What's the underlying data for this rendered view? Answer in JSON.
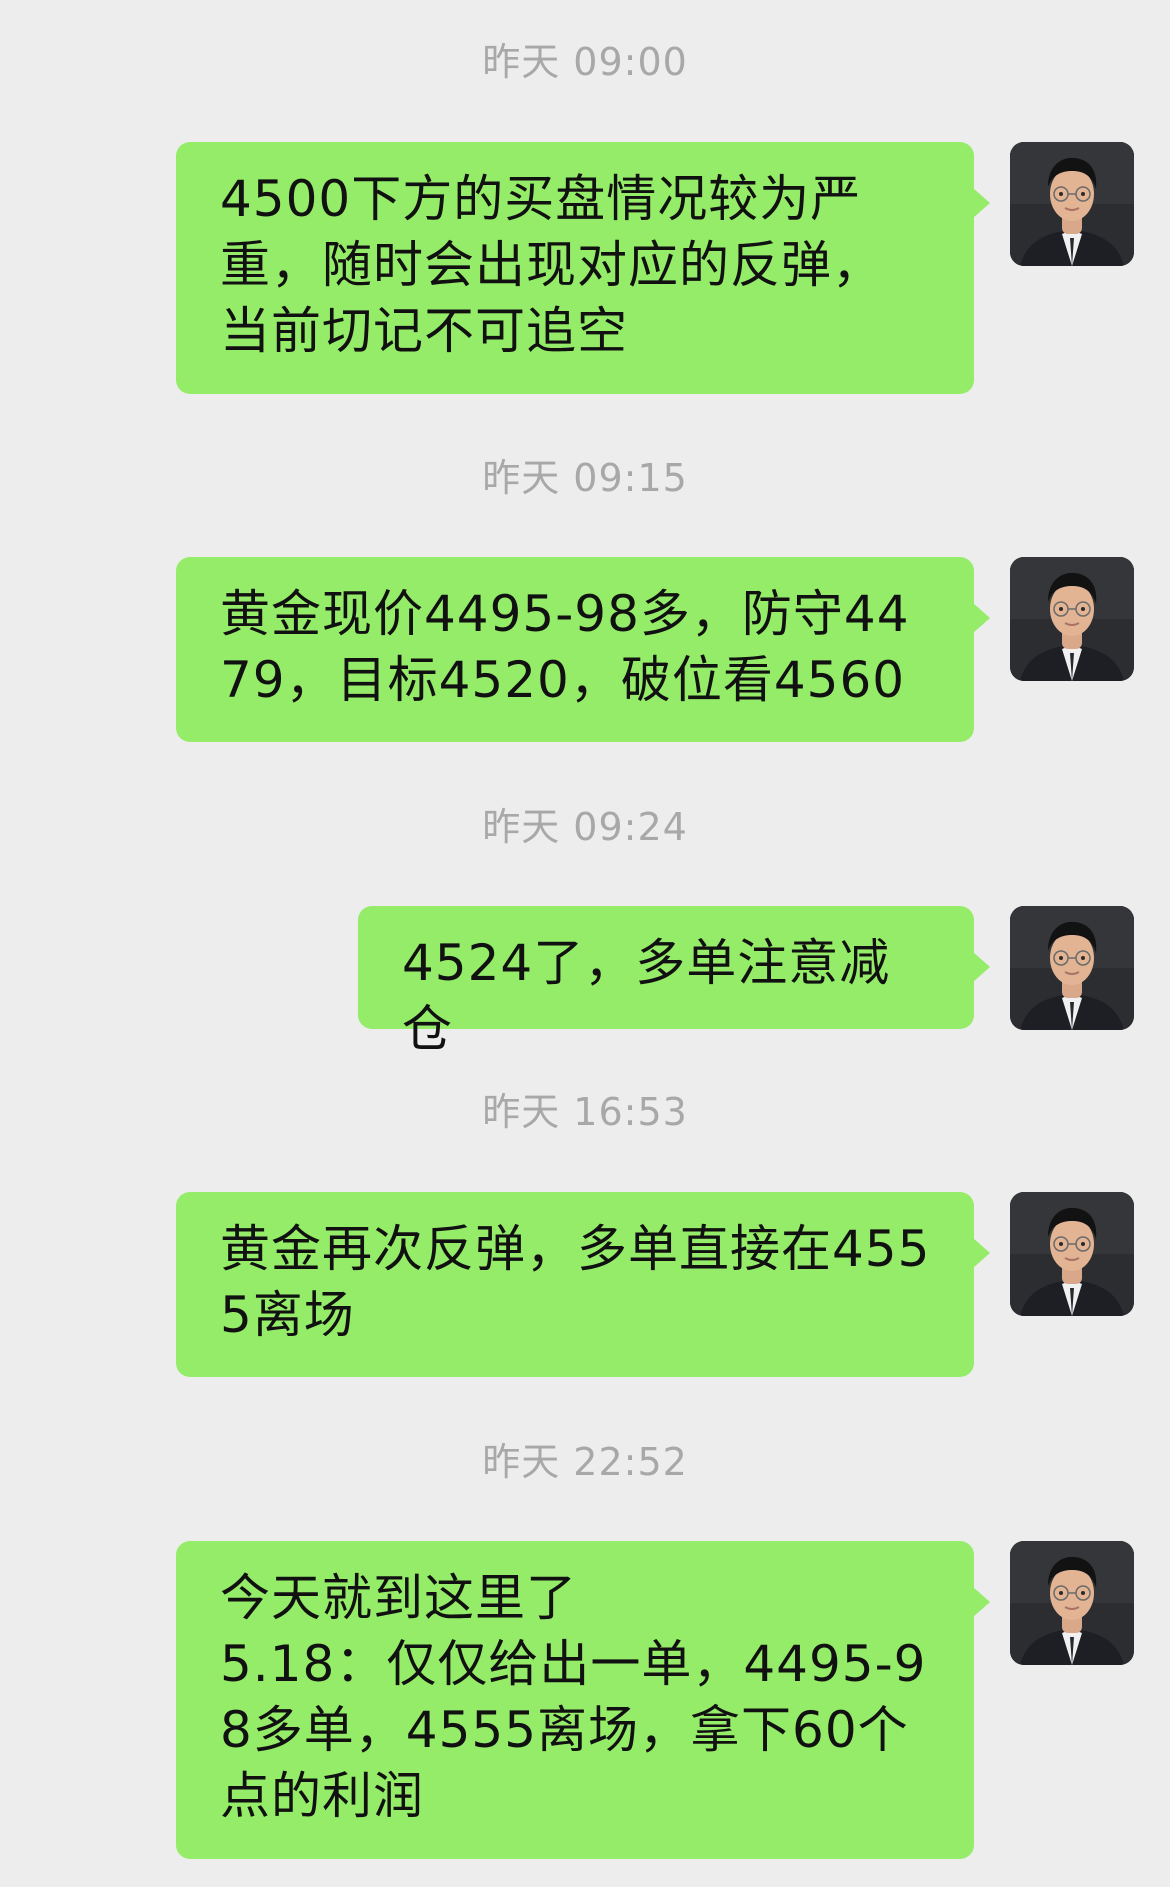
{
  "messages": [
    {
      "timestamp": "昨天 09:00",
      "text": "4500下方的买盘情况较为严重，随时会出现对应的反弹，当前切记不可追空"
    },
    {
      "timestamp": "昨天 09:15",
      "text": "黄金现价4495-98多，防守4479，目标4520，破位看4560"
    },
    {
      "timestamp": "昨天 09:24",
      "text": "4524了，多单注意减仓"
    },
    {
      "timestamp": "昨天 16:53",
      "text": "黄金再次反弹，多单直接在4555离场"
    },
    {
      "timestamp": "昨天 22:52",
      "text": "今天就到这里了\n5.18：仅仅给出一单，4495-98多单，4555离场，拿下60个点的利润"
    }
  ],
  "colors": {
    "background": "#ededed",
    "bubble": "#95ec69",
    "timestamp_text": "#a8a8a8",
    "message_text": "#111111"
  },
  "icons": {
    "avatar": "sender-avatar-photo"
  }
}
